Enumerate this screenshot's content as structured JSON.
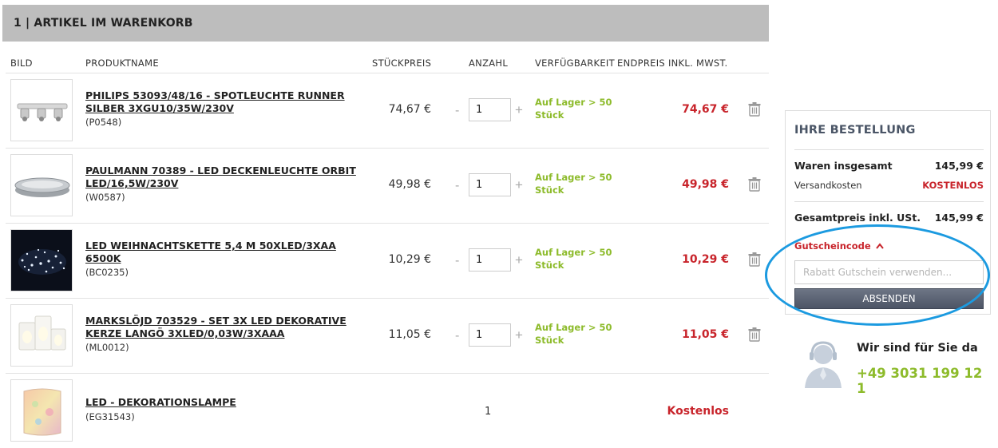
{
  "cart": {
    "header": "1 | ARTIKEL IM WARENKORB",
    "columns": {
      "image": "BILD",
      "name": "PRODUKTNAME",
      "unit_price": "STÜCKPREIS",
      "quantity": "ANZAHL",
      "availability": "VERFÜGBARKEIT",
      "total": "ENDPREIS INKL. MWST."
    },
    "items": [
      {
        "name": "PHILIPS 53093/48/16 - SPOTLEUCHTE RUNNER SILBER 3XGU10/35W/230V",
        "sku": "(P0548)",
        "unit_price": "74,67 €",
        "qty_minus": "-",
        "quantity": "1",
        "qty_plus": "+",
        "availability": "Auf Lager > 50 Stück",
        "total": "74,67 €",
        "delete_icon": "trash-icon"
      },
      {
        "name": "PAULMANN 70389 - LED DECKENLEUCHTE ORBIT LED/16,5W/230V",
        "sku": "(W0587)",
        "unit_price": "49,98 €",
        "qty_minus": "-",
        "quantity": "1",
        "qty_plus": "+",
        "availability": "Auf Lager > 50 Stück",
        "total": "49,98 €",
        "delete_icon": "trash-icon"
      },
      {
        "name": "LED WEIHNACHTSKETTE 5,4 M 50XLED/3XAA 6500K",
        "sku": "(BC0235)",
        "unit_price": "10,29 €",
        "qty_minus": "-",
        "quantity": "1",
        "qty_plus": "+",
        "availability": "Auf Lager > 50 Stück",
        "total": "10,29 €",
        "delete_icon": "trash-icon"
      },
      {
        "name": "MARKSLÖJD 703529 - SET 3X LED DEKORATIVE KERZE LANGÖ 3XLED/0,03W/3XAAA",
        "sku": "(ML0012)",
        "unit_price": "11,05 €",
        "qty_minus": "-",
        "quantity": "1",
        "qty_plus": "+",
        "availability": "Auf Lager > 50 Stück",
        "total": "11,05 €",
        "delete_icon": "trash-icon"
      },
      {
        "name": "LED - DEKORATIONSLAMPE",
        "sku": "(EG31543)",
        "quantity": "1",
        "total": "Kostenlos"
      }
    ]
  },
  "order": {
    "title": "IHRE BESTELLUNG",
    "goods_label": "Waren insgesamt",
    "goods_value": "145,99 €",
    "shipping_label": "Versandkosten",
    "shipping_value": "KOSTENLOS",
    "grand_total_label": "Gesamtpreis inkl. USt.",
    "grand_total_value": "145,99 €",
    "coupon_toggle": "Gutscheincode",
    "coupon_placeholder": "Rabatt Gutschein verwenden...",
    "coupon_value": "",
    "submit_label": "ABSENDEN"
  },
  "support": {
    "text": "Wir sind für Sie da",
    "phone": "+49 3031 199 12 1",
    "icon": "headset-agent-icon"
  },
  "colors": {
    "header_bg": "#bdbdbd",
    "accent_red": "#c8242b",
    "availability_green": "#8dbb2b",
    "annotation_blue": "#1b9ae0",
    "button_bg": "#5a6272"
  }
}
